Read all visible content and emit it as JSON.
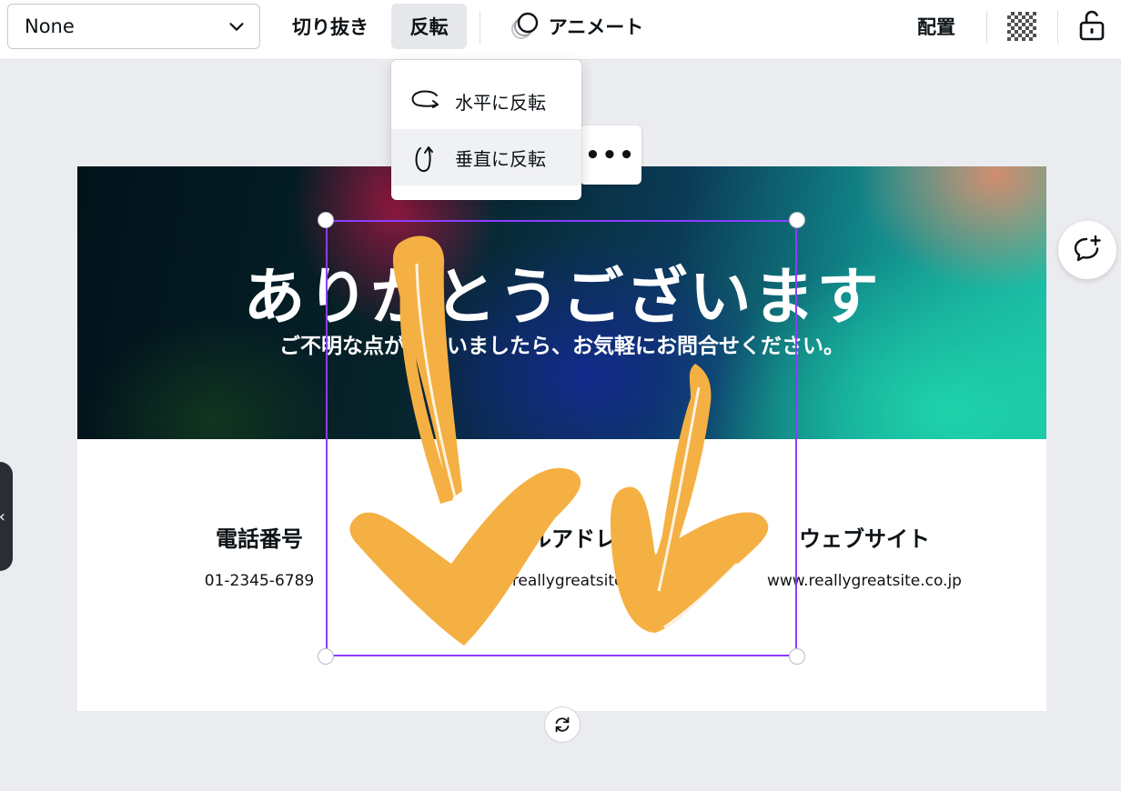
{
  "toolbar": {
    "select_value": "None",
    "crop_label": "切り抜き",
    "flip_label": "反転",
    "animate_label": "アニメート",
    "position_label": "配置",
    "icons": [
      "chevron-down-icon",
      "animate-icon",
      "transparency-icon",
      "lock-icon"
    ]
  },
  "flip_menu": {
    "items": [
      {
        "label": "水平に反転",
        "icon": "flip-horizontal-icon"
      },
      {
        "label": "垂直に反転",
        "icon": "flip-vertical-icon"
      }
    ]
  },
  "more_label": "•••",
  "side_tab_glyph": "‹",
  "design": {
    "title": "ありがとうございます",
    "subtitle": "ご不明な点がございましたら、お気軽にお問合せください。",
    "contacts": [
      {
        "heading": "電話番号",
        "value": "01-2345-6789"
      },
      {
        "heading": "メールアドレス",
        "value": "hello@reallygreatsite.co.jp"
      },
      {
        "heading": "ウェブサイト",
        "value": "www.reallygreatsite.co.jp"
      }
    ]
  },
  "colors": {
    "selection": "#8b3dff",
    "arrow": "#f5b043",
    "canvas_bg": "#ebecf0"
  }
}
